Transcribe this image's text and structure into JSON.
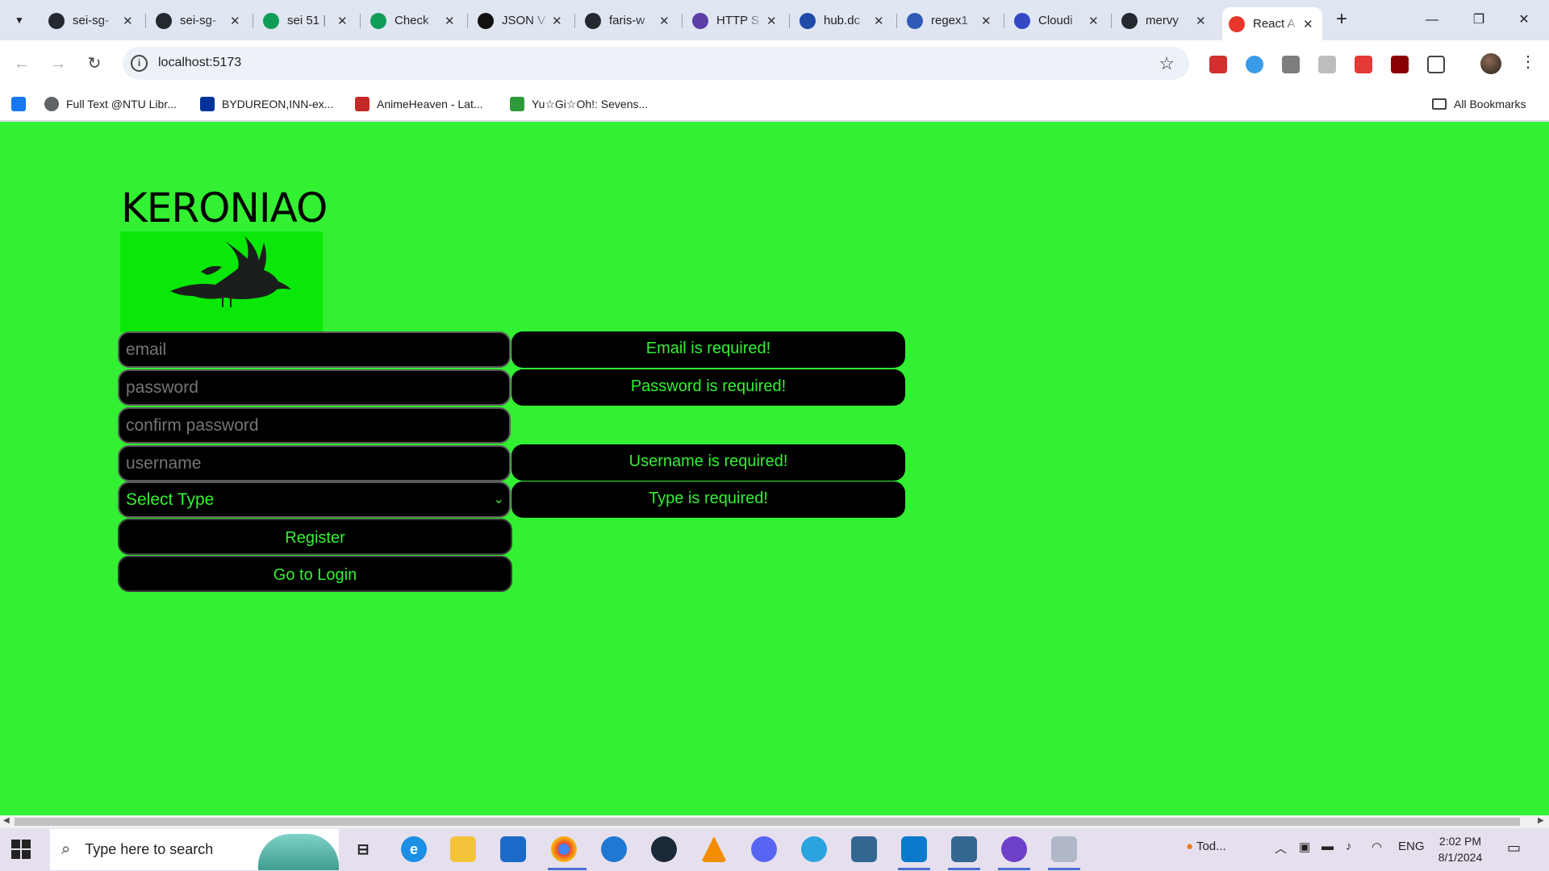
{
  "browser": {
    "tabs": [
      {
        "title": "sei-sg-",
        "icon": "github-icon",
        "color": "#24292f"
      },
      {
        "title": "sei-sg-",
        "icon": "github-icon",
        "color": "#24292f"
      },
      {
        "title": "sei 51 |",
        "icon": "sheets-icon",
        "color": "#0f9d58"
      },
      {
        "title": "Check",
        "icon": "sheets-icon",
        "color": "#0f9d58"
      },
      {
        "title": "JSON V",
        "icon": "json-icon",
        "color": "#111111"
      },
      {
        "title": "faris-w",
        "icon": "github-icon",
        "color": "#24292f"
      },
      {
        "title": "HTTP S",
        "icon": "http-icon",
        "color": "#5b3fa6"
      },
      {
        "title": "hub.dc",
        "icon": "docker-hub-icon",
        "color": "#1f4aa8"
      },
      {
        "title": "regex1",
        "icon": "regex-icon",
        "color": "#2f5bb7"
      },
      {
        "title": "Cloudi",
        "icon": "cloudinary-icon",
        "color": "#3448c5"
      },
      {
        "title": "mervy",
        "icon": "github-icon",
        "color": "#24292f"
      },
      {
        "title": "React A",
        "icon": "ga-icon",
        "color": "#e8362d"
      }
    ],
    "url": "localhost:5173",
    "bookmarks": [
      {
        "label": "",
        "icon": "facebook-icon",
        "color": "#1877f2"
      },
      {
        "label": "Full Text @NTU Libr...",
        "icon": "globe-icon",
        "color": "#5f6368"
      },
      {
        "label": "BYDUREON,INN-ex...",
        "icon": "eu-flag-icon",
        "color": "#003399"
      },
      {
        "label": "AnimeHeaven - Lat...",
        "icon": "animeheaven-icon",
        "color": "#c62828"
      },
      {
        "label": "Yu☆Gi☆Oh!: Sevens...",
        "icon": "tv-icon",
        "color": "#2e9b3a"
      }
    ],
    "all_bookmarks": "All Bookmarks"
  },
  "page": {
    "title": "KERONIAO",
    "form": {
      "email_placeholder": "email",
      "password_placeholder": "password",
      "confirm_placeholder": "confirm password",
      "username_placeholder": "username",
      "type_selected": "Select Type",
      "register_label": "Register",
      "login_label": "Go to Login"
    },
    "errors": {
      "email": "Email is required!",
      "password": "Password is required!",
      "username": "Username is required!",
      "type": "Type is required!"
    }
  },
  "taskbar": {
    "search_placeholder": "Type here to search",
    "weather": "Tod...",
    "language": "ENG",
    "time": "2:02 PM",
    "date": "8/1/2024"
  }
}
